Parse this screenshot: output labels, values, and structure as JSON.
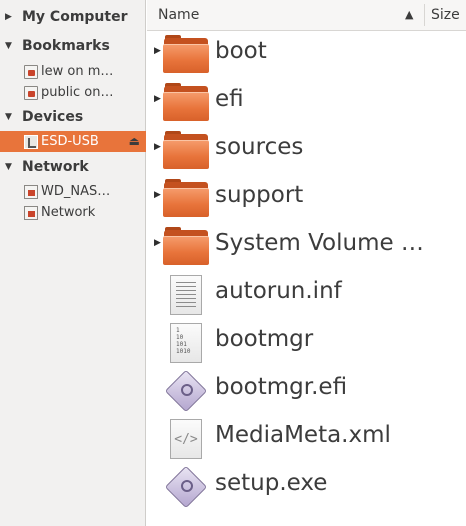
{
  "sidebar": {
    "sections": [
      {
        "label": "My Computer",
        "expanded": false
      },
      {
        "label": "Bookmarks",
        "expanded": true,
        "items": [
          {
            "label": "lew on m…",
            "icon": "network-share-icon"
          },
          {
            "label": "public on…",
            "icon": "network-share-icon"
          }
        ]
      },
      {
        "label": "Devices",
        "expanded": true,
        "items": [
          {
            "label": "ESD-USB",
            "icon": "usb-drive-icon",
            "selected": true,
            "eject": "⏏"
          }
        ]
      },
      {
        "label": "Network",
        "expanded": true,
        "items": [
          {
            "label": "WD_NAS…",
            "icon": "network-server-icon"
          },
          {
            "label": "Network",
            "icon": "network-icon"
          }
        ]
      }
    ]
  },
  "columns": {
    "name": "Name",
    "size": "Size",
    "sort_indicator": "▲"
  },
  "files": [
    {
      "name": "boot",
      "type": "folder"
    },
    {
      "name": "efi",
      "type": "folder"
    },
    {
      "name": "sources",
      "type": "folder"
    },
    {
      "name": "support",
      "type": "folder"
    },
    {
      "name": "System Volume …",
      "type": "folder"
    },
    {
      "name": "autorun.inf",
      "type": "text"
    },
    {
      "name": "bootmgr",
      "type": "binary"
    },
    {
      "name": "bootmgr.efi",
      "type": "executable"
    },
    {
      "name": "MediaMeta.xml",
      "type": "xml"
    },
    {
      "name": "setup.exe",
      "type": "executable"
    }
  ],
  "binary_icon_text": [
    "1",
    "10",
    "101",
    "1010"
  ],
  "xml_icon_text": "</>",
  "colors": {
    "accent": "#e8743b",
    "sidebar_bg": "#f2f1f0",
    "folder": "#e8743b"
  }
}
